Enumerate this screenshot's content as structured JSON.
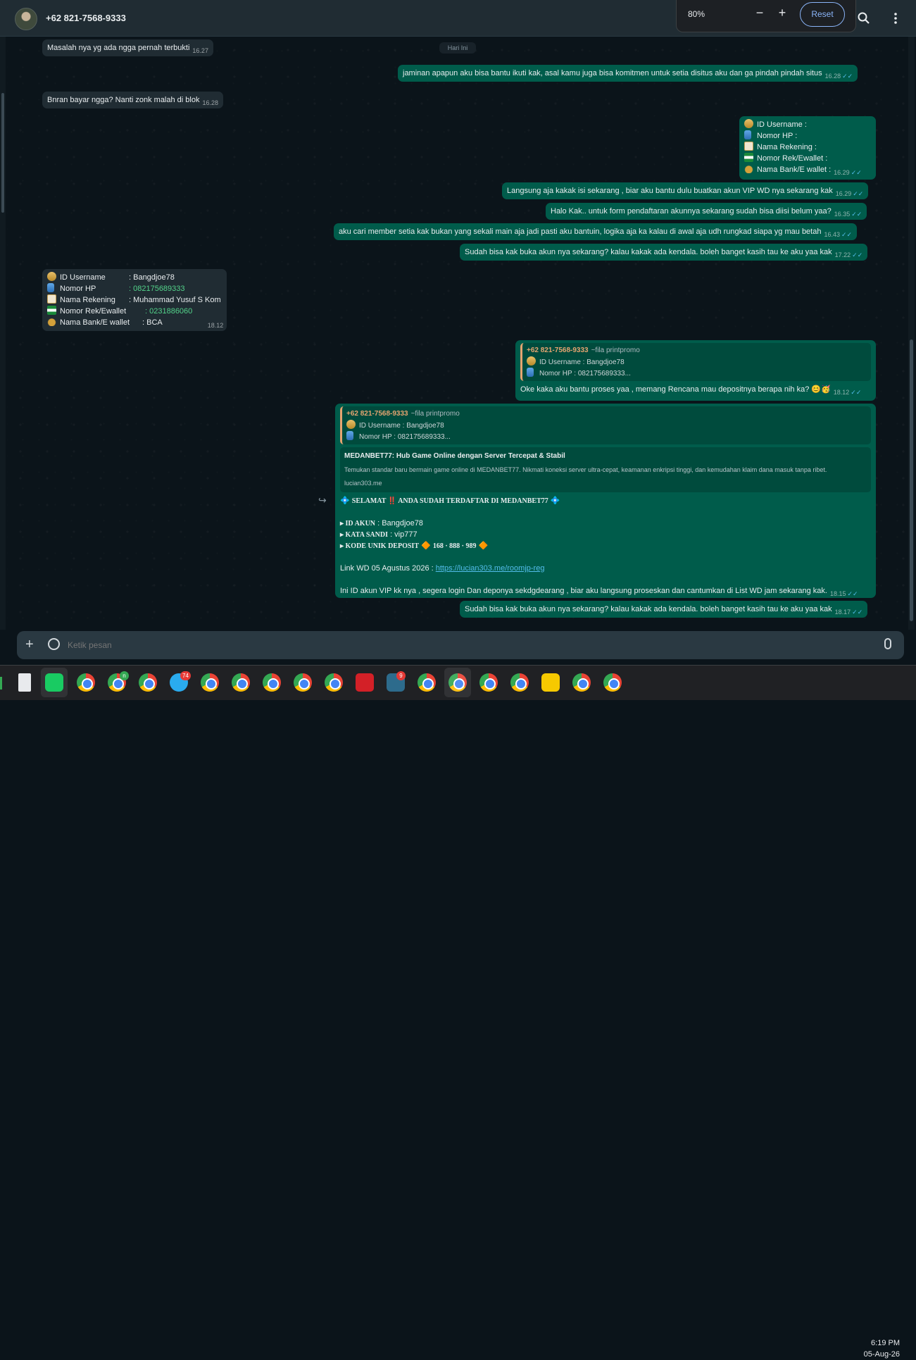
{
  "header": {
    "contact": "+62 821-7568-9333"
  },
  "zoom": {
    "level": "80%",
    "minus": "−",
    "plus": "+",
    "reset": "Reset"
  },
  "date_chip": "Hari Ini",
  "messages": {
    "m1": {
      "text": "Masalah nya yg ada ngga pernah terbukti",
      "time": "16.27"
    },
    "m2": {
      "text": "jaminan apapun aku bisa bantu ikuti kak, asal kamu juga bisa komitmen untuk setia disitus aku dan ga pindah pindah situs",
      "time": "16.28"
    },
    "m3": {
      "text": "Bnran bayar ngga? Nanti zonk malah di blok",
      "time": "16.28"
    },
    "m4": {
      "rows": [
        "ID Username        :",
        "Nomor HP            :",
        "Nama Rekening     :",
        "Nomor Rek/Ewallet      :",
        "Nama Bank/E wallet  :"
      ],
      "time": "16.29"
    },
    "m5": {
      "text": "Langsung aja kakak isi sekarang , biar aku bantu dulu buatkan akun VIP WD nya sekarang kak",
      "time": "16.29"
    },
    "m6": {
      "text": "Halo Kak.. untuk form pendaftaran akunnya sekarang sudah bisa diisi belum yaa?",
      "time": "16.35"
    },
    "m7": {
      "text": "aku cari member setia kak bukan yang sekali main aja  jadi pasti aku bantuin, logika aja ka kalau di awal aja udh rungkad siapa yg mau betah",
      "time": "16.43"
    },
    "m8": {
      "text": "Sudah bisa kak buka akun nya sekarang? kalau kakak ada kendala. boleh banget kasih tau ke aku yaa kak",
      "time": "17.22"
    },
    "m9": {
      "labels": [
        "ID Username",
        "Nomor HP",
        "Nama Rekening",
        "Nomor Rek/Ewallet",
        "Nama Bank/E wallet"
      ],
      "values": [
        ": Bangdjoe78",
        ": 082175689333",
        ": Muhammad Yusuf S Kom",
        ": 0231886060",
        ": BCA"
      ],
      "time": "18.12"
    },
    "m10": {
      "quote_name": "+62 821-7568-9333",
      "quote_alias": "~fila printpromo",
      "quote_rows": [
        "ID Username      : Bangdjoe78",
        "Nomor HP          : 082175689333..."
      ],
      "text": "Oke kaka aku bantu proses yaa , memang  Rencana mau depositnya berapa nih ka? 😊🥳",
      "time": "18.12"
    },
    "m11": {
      "quote_name": "+62 821-7568-9333",
      "quote_alias": "~fila printpromo",
      "quote_rows": [
        "ID Username      : Bangdjoe78",
        "Nomor HP          : 082175689333..."
      ],
      "preview_title": "MEDANBET77: Hub Game Online dengan Server Tercepat & Stabil",
      "preview_desc": "Temukan standar baru bermain game online di MEDANBET77. Nikmati koneksi server ultra-cepat, keamanan enkripsi tinggi, dan kemudahan klaim dana masuk tanpa ribet.",
      "preview_url": "lucian303.me",
      "headline": "SELAMAT ‼️ ANDA SUDAH TERDAFTAR DI MEDANBET77",
      "akun_label": "▸ ID AKUN",
      "akun_value": ": Bangdjoe78",
      "sandi_label": "▸ KATA SANDI",
      "sandi_value": ": vip777",
      "kode_label": "▸ KODE UNIK DEPOSIT",
      "kode_value": "168 · 888 · 989",
      "link_label": "Link WD 05 Agustus 2026 :",
      "link_url": "https://lucian303.me/roomjp-reg",
      "text": "Ini ID akun VIP kk nya , segera login Dan deponya sekdgdearang , biar aku langsung  proseskan dan cantumkan di List WD jam sekarang kak.",
      "time": "18.15"
    },
    "m12": {
      "text": "Sudah bisa kak buka akun nya sekarang? kalau kakak ada kendala. boleh banget kasih tau ke aku yaa kak",
      "time": "18.17"
    }
  },
  "composer": {
    "placeholder": "Ketik pesan"
  },
  "taskbar": {
    "badges": {
      "chrome3": "n",
      "tele": "74",
      "game": "9"
    },
    "time": "6:19 PM",
    "date": "05-Aug-26"
  },
  "colors": {
    "header_bg": "#202c33",
    "chat_bg": "#0b141a",
    "incoming": "#202c33",
    "outgoing": "#005c4b",
    "tick": "#53bdeb",
    "accent_green": "#53d28a",
    "quote_name": "#e5a470"
  }
}
